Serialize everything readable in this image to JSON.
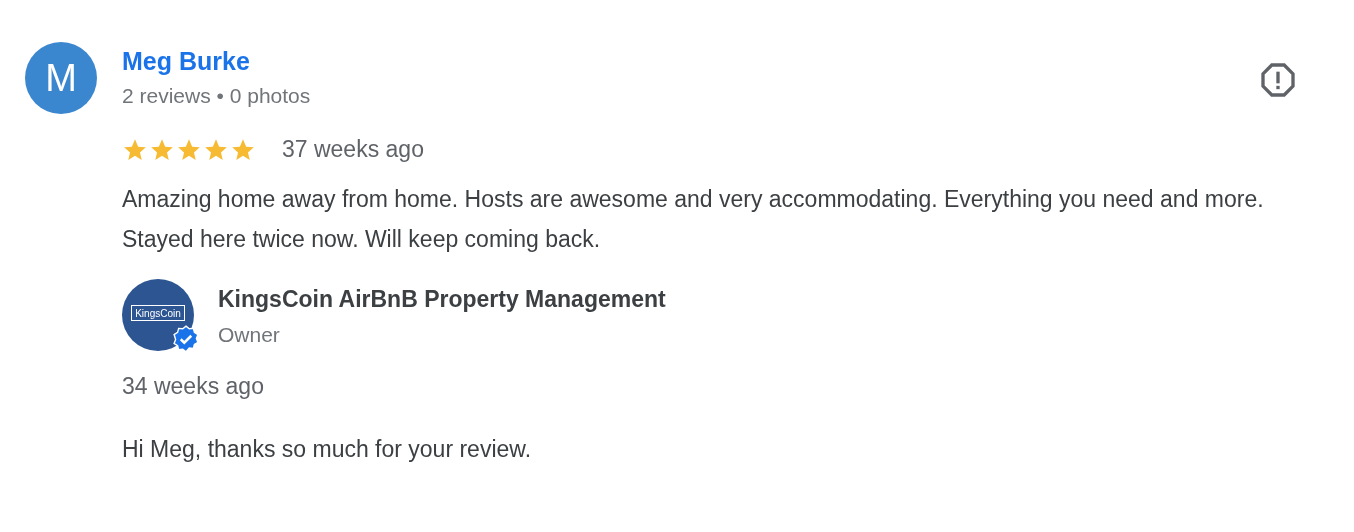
{
  "review": {
    "author_initial": "M",
    "author": "Meg Burke",
    "author_meta": "2 reviews • 0 photos",
    "stars": 5,
    "time": "37 weeks ago",
    "text": "Amazing home away from home. Hosts are awesome and very accommodating. Everything you need and more. Stayed here twice now. Will keep coming back."
  },
  "owner_reply": {
    "logo_text": "KingsCoin",
    "verified": true,
    "name": "KingsCoin AirBnB Property Management",
    "role": "Owner",
    "time": "34 weeks ago",
    "text": "Hi Meg, thanks so much for your review."
  }
}
